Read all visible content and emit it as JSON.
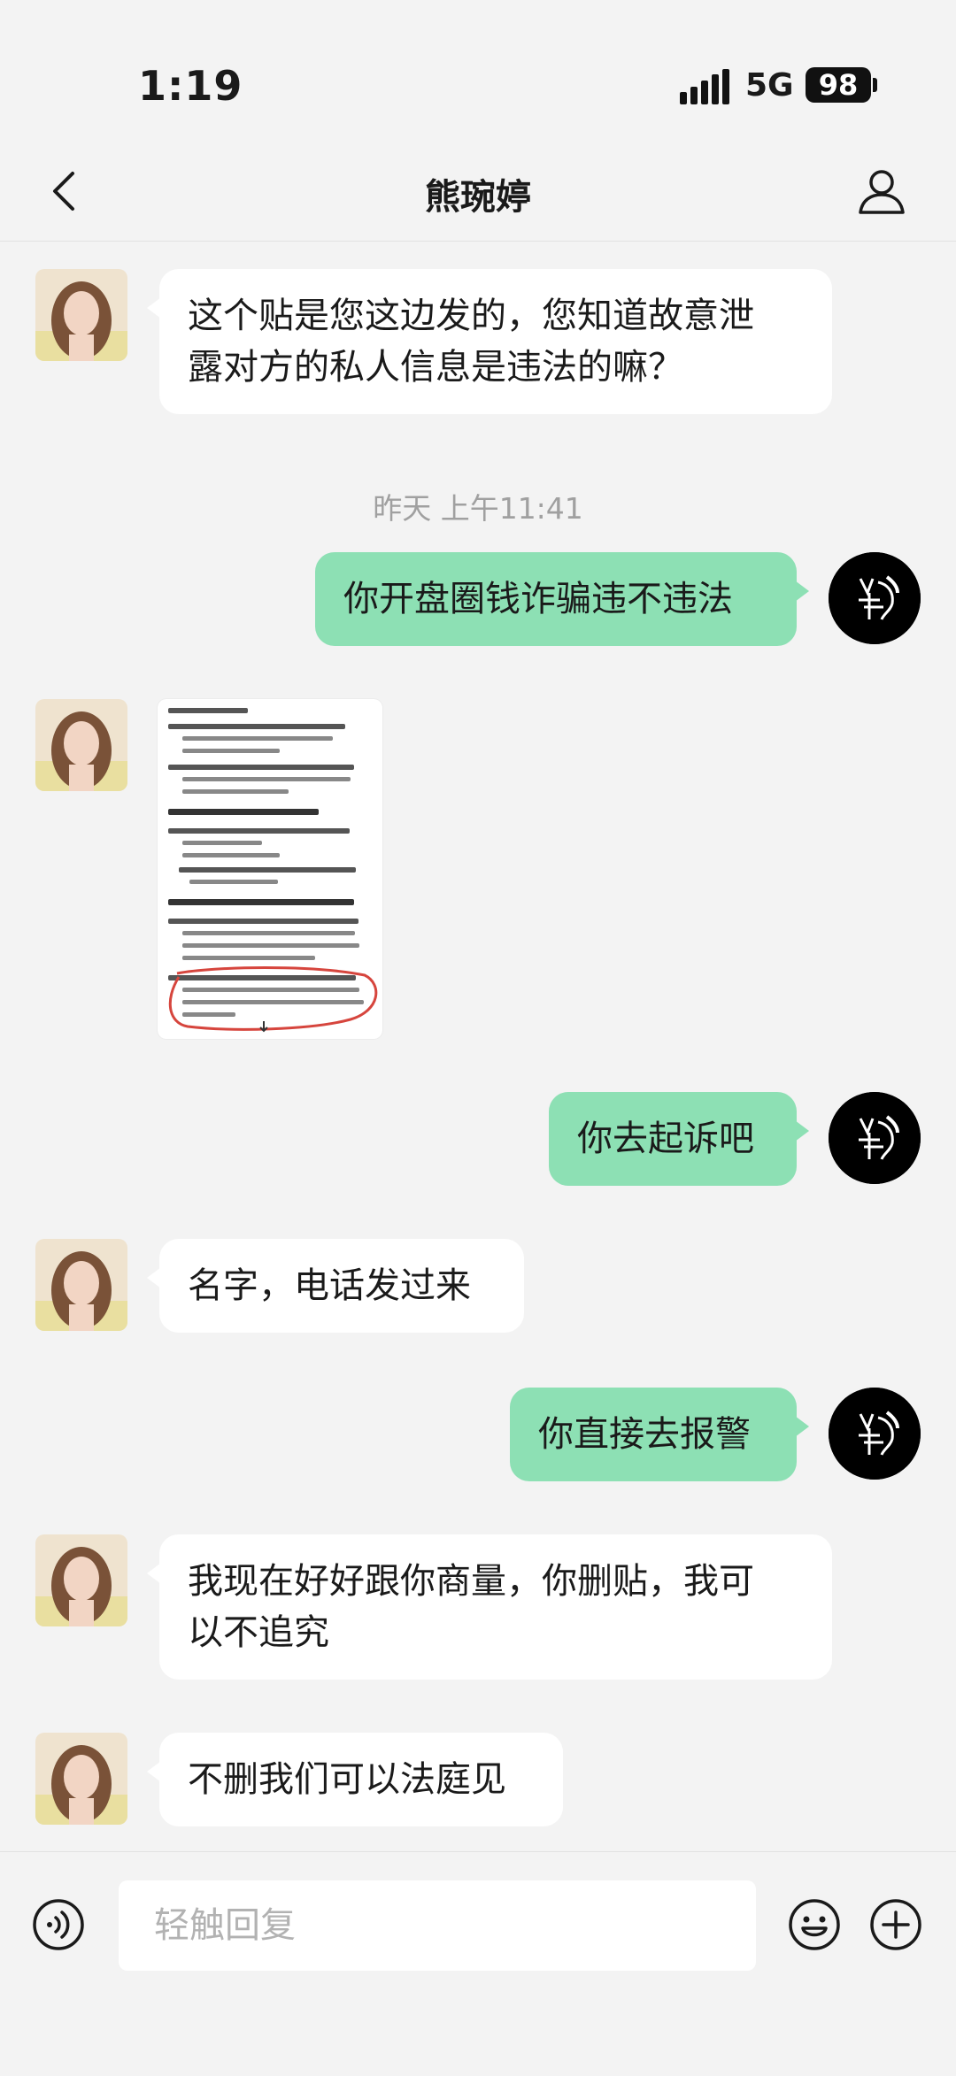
{
  "status_bar": {
    "time": "1:19",
    "network": "5G",
    "battery": "98"
  },
  "header": {
    "title": "熊琬婷",
    "back_icon": "chevron-left-icon",
    "profile_icon": "person-icon"
  },
  "messages": [
    {
      "sender": "contact",
      "type": "text",
      "lines": [
        "这个贴是您这边发的，您知道故意泄",
        "露对方的私人信息是违法的嘛？"
      ]
    },
    {
      "type": "timestamp",
      "text": "昨天 上午11:41"
    },
    {
      "sender": "me",
      "type": "text",
      "text": "你开盘圈钱诈骗违不违法"
    },
    {
      "sender": "contact",
      "type": "image"
    },
    {
      "sender": "me",
      "type": "text",
      "text": "你去起诉吧"
    },
    {
      "sender": "contact",
      "type": "text",
      "text": "名字，电话发过来"
    },
    {
      "sender": "me",
      "type": "text",
      "text": "你直接去报警"
    },
    {
      "sender": "contact",
      "type": "text",
      "lines": [
        "我现在好好跟你商量，你删贴，我可",
        "以不追究"
      ]
    },
    {
      "sender": "contact",
      "type": "text",
      "text": "不删我们可以法庭见"
    }
  ],
  "input_bar": {
    "placeholder": "轻触回复",
    "value": "",
    "voice_icon": "voice-icon",
    "emoji_icon": "emoji-icon",
    "plus_icon": "plus-icon"
  },
  "colors": {
    "sent_bubble": "#8de0b4",
    "received_bubble": "#ffffff",
    "background": "#f3f3f3"
  }
}
